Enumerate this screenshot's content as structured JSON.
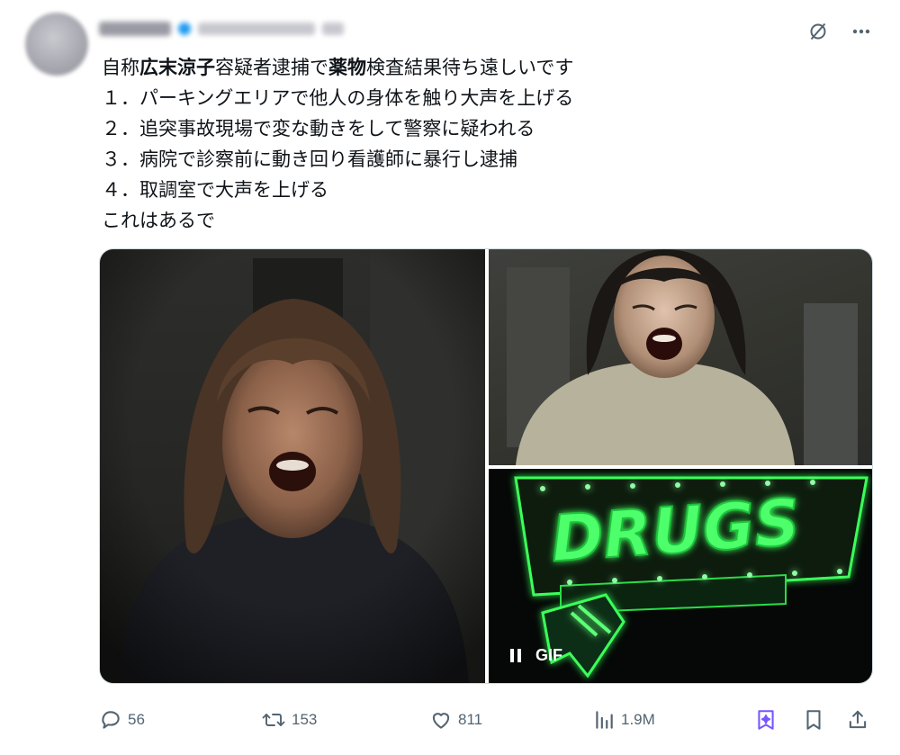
{
  "tweet": {
    "lines": [
      {
        "pre": "自称",
        "bold": "広末涼子",
        "mid": "容疑者逮捕で",
        "bold2": "薬物",
        "post": "検査結果待ち遠しいです"
      },
      {
        "text": "１．パーキングエリアで他人の身体を触り大声を上げる"
      },
      {
        "text": "２．追突事故現場で変な動きをして警察に疑われる"
      },
      {
        "text": "３．病院で診察前に動き回り看護師に暴行し逮捕"
      },
      {
        "text": "４．取調室で大声を上げる"
      },
      {
        "text": "これはあるで"
      }
    ]
  },
  "media": {
    "sign_text": "DRUGS",
    "gif_label": "GIF"
  },
  "actions": {
    "replies": "56",
    "reposts": "153",
    "likes": "811",
    "views": "1.9M"
  },
  "colors": {
    "text": "#0f1419",
    "muted": "#536471",
    "grok": "#7856ff",
    "neon": "#39ff55"
  },
  "icons": [
    "grok-slash-icon",
    "more-icon",
    "reply-icon",
    "repost-icon",
    "like-icon",
    "views-icon",
    "grok-icon",
    "bookmark-icon",
    "share-icon",
    "pause-icon"
  ]
}
